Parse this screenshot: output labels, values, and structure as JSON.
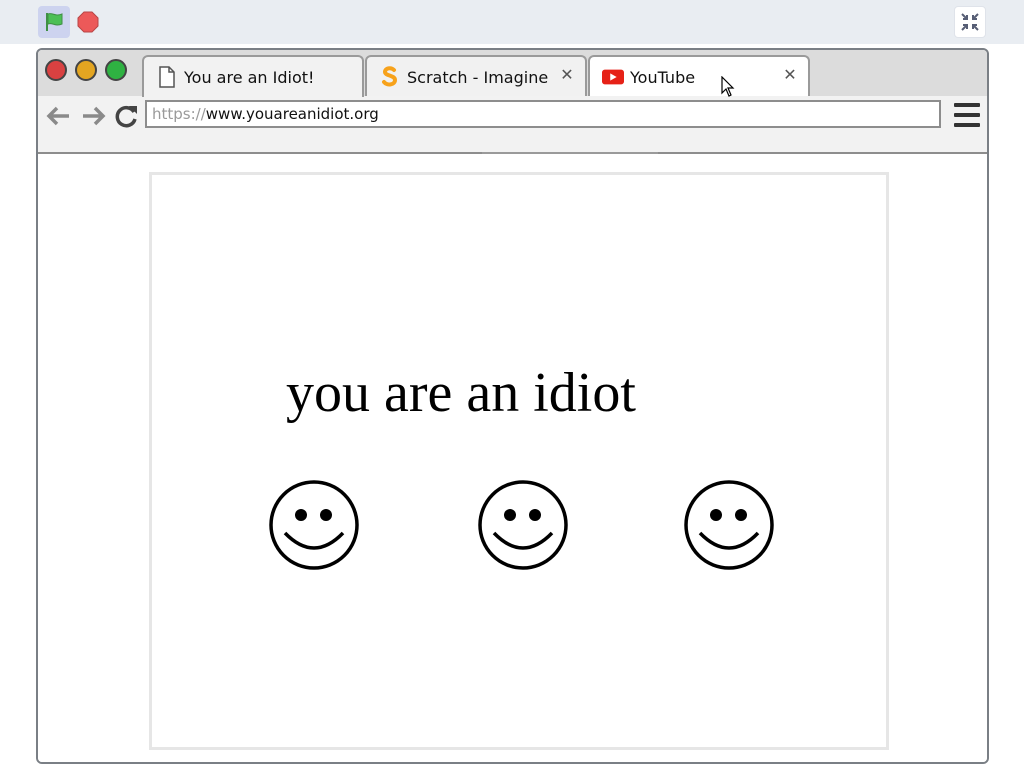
{
  "stage": {
    "controls": {
      "flag_color": "#4cbf56",
      "stop_color": "#ec5959"
    }
  },
  "browser": {
    "tabs": [
      {
        "label": "You are an Idiot!",
        "icon": "document-icon",
        "active": true,
        "has_close": false
      },
      {
        "label": "Scratch - Imagine",
        "icon": "scratch-icon",
        "active": false,
        "has_close": true
      },
      {
        "label": "YouTube",
        "icon": "youtube-icon",
        "active": false,
        "has_close": true
      }
    ],
    "close_glyph": "✕",
    "address": {
      "scheme": "https://",
      "host": "www.youareanidiot.org"
    }
  },
  "page": {
    "headline": "you are an idiot",
    "smiley_count": 3
  },
  "colors": {
    "traffic_red": "#d94141",
    "traffic_yellow": "#e3a521",
    "traffic_green": "#2fb242",
    "youtube_red": "#e62117",
    "scratch_orange": "#f7a21b"
  }
}
